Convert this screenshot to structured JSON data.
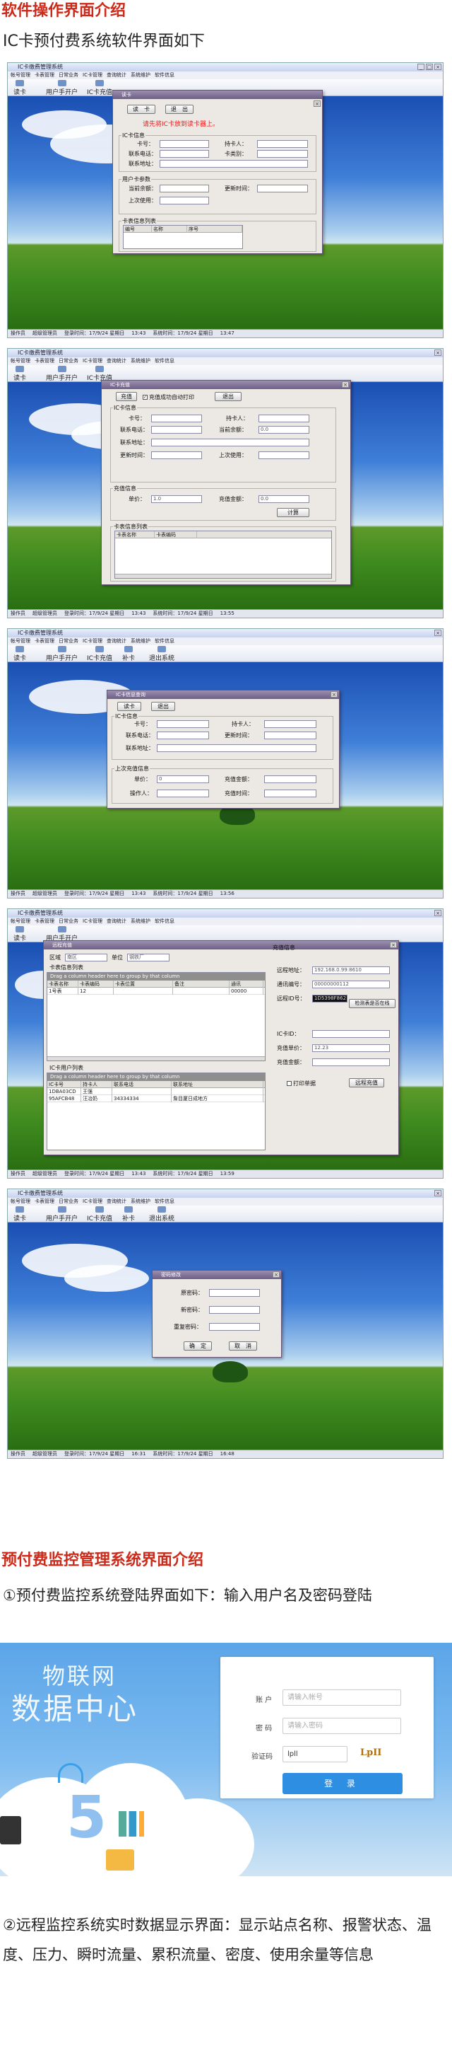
{
  "section1": {
    "title": "软件操作界面介绍",
    "subtitle": "IC卡预付费系统软件界面如下"
  },
  "app": {
    "window_title": "IC卡缴费管理系统",
    "menus": [
      "帐号管理",
      "卡表管理",
      "日常业务",
      "IC卡管理",
      "查询统计",
      "系统维护",
      "软件信息"
    ],
    "toolbar": [
      "读卡",
      "用户手开户",
      "IC卡充值",
      "补卡",
      "退出系统"
    ],
    "status": {
      "op": "操作员",
      "user": "超级管理员",
      "login_time": "登录时间：17/9/24 星期日",
      "t1": "13:43",
      "sys_time": "系统时间：17/9/24 星期日",
      "t2": "13:47"
    }
  },
  "shot1": {
    "dialog_title": "读卡",
    "read_btn": "读　卡",
    "exit_btn": "退　出",
    "message": "请先将IC卡放到读卡器上。",
    "card_info": "IC卡信息",
    "card_no": "卡号：",
    "holder": "持卡人：",
    "phone": "联系电话：",
    "card_type": "卡类别：",
    "address": "联系地址：",
    "user_group": "用户卡参数",
    "balance": "当前余额：",
    "update_time": "更新时间：",
    "last_use": "上次使用：",
    "table_group": "卡表信息列表",
    "cols": [
      "编号",
      "名称",
      "序号"
    ],
    "status_t2": "13:47"
  },
  "shot2": {
    "dialog_title": "IC卡充值",
    "charge_btn": "充值",
    "print_label": "充值成功自动打印",
    "exit_btn": "退出",
    "card_info": "IC卡信息",
    "card_no": "卡号：",
    "holder": "持卡人：",
    "phone": "联系电话：",
    "balance": "当前余额：",
    "balance_val": "0.0",
    "address": "联系地址：",
    "update_time": "更新时间：",
    "last_use": "上次使用：",
    "charge_group": "充值信息",
    "unit_price": "单价：",
    "unit_val": "1.0",
    "charge_amt": "充值金额：",
    "amt_val": "0.0",
    "calc_btn": "计算",
    "table_group": "卡表信息列表",
    "cols": [
      "卡表名称",
      "卡表编码"
    ],
    "status_t2": "13:55"
  },
  "shot3": {
    "dialog_title": "IC卡信息查询",
    "read_btn": "读卡",
    "exit_btn": "退出",
    "card_info": "IC卡信息",
    "card_no": "卡号：",
    "holder": "持卡人：",
    "phone": "联系电话：",
    "update_time": "更新时间：",
    "address": "联系地址：",
    "last_charge": "上次充值信息",
    "unit_price": "单价：",
    "unit_val": "0",
    "charge_amt": "充值金额：",
    "operator": "操作人：",
    "charge_time": "充值时间：",
    "status_t2": "13:56"
  },
  "shot4": {
    "dialog_title": "远程充值",
    "region_label": "区域",
    "region_val": "南区",
    "unit_label": "单位",
    "unit_val": "钢铁厂",
    "list_group": "卡表信息列表",
    "drag_hint": "Drag a column header here to group by that column",
    "cols": [
      "卡表名称",
      "卡表编码",
      "卡表位置",
      "备注",
      "通讯"
    ],
    "rows": [
      [
        "1号表",
        "12",
        "",
        "",
        "00000"
      ]
    ],
    "user_group": "IC卡用户列表",
    "ucols": [
      "IC卡号",
      "持卡人",
      "联系电话",
      "联系地址"
    ],
    "urows": [
      [
        "1DBA03CD",
        "王强",
        "",
        ""
      ],
      [
        "95AFCB48",
        "汪冶奶",
        "34334334",
        "詹目厦日成地方"
      ]
    ],
    "charge_info": "充值信息",
    "remote_addr": "远程地址：",
    "addr_val": "192.168.0.99:8610",
    "comm_no": "通讯编号：",
    "comm_val": "00000000112",
    "remote_id": "远程ID号：",
    "id_val": "1D5398F862",
    "check_btn": "检测表是否在线",
    "card_id": "IC卡ID：",
    "charge_price": "充值单价：",
    "price_val": "12.23",
    "charge_amt": "充值金额：",
    "print_label": "打印单据",
    "remote_btn": "远程充值",
    "status_t2": "13:59"
  },
  "shot5": {
    "dialog_title": "密码修改",
    "old_pw": "原密码：",
    "new_pw": "新密码：",
    "repeat_pw": "重复密码：",
    "ok_btn": "确　定",
    "cancel_btn": "取　消",
    "status_t1": "16:31",
    "status_t2": "16:48"
  },
  "section2": {
    "title": "预付费监控管理系统界面介绍",
    "subtitle": "①预付费监控系统登陆界面如下：输入用户名及密码登陆"
  },
  "login": {
    "bg_line1": "物联网",
    "bg_line2": "数据中心",
    "account_label": "账 户",
    "account_placeholder": "请输入帐号",
    "password_label": "密 码",
    "password_placeholder": "请输入密码",
    "captcha_label": "验证码",
    "captcha_input": "lpll",
    "captcha_image": "LpII",
    "login_btn": "登 录",
    "logo_digit": "5"
  },
  "section3": {
    "text": "②远程监控系统实时数据显示界面：显示站点名称、报警状态、温度、压力、瞬时流量、累积流量、密度、使用余量等信息"
  }
}
